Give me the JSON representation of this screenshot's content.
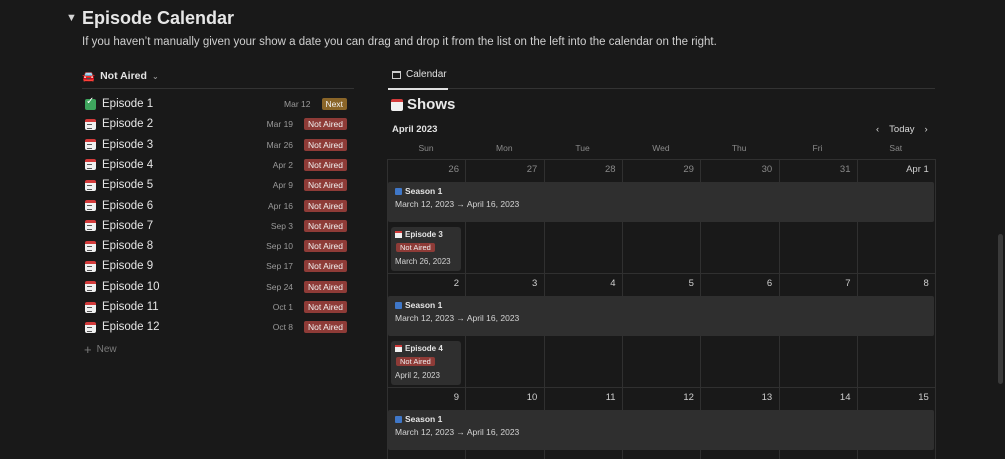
{
  "section": {
    "toggle": "▼",
    "title": "Episode Calendar",
    "description": "If you haven’t manually given your show a date you can drag and drop it from the list on the left into the calendar on the right."
  },
  "list": {
    "view_label": "Not Aired",
    "new_label": "New",
    "rows": [
      {
        "name": "Episode 1",
        "date": "Mar 12",
        "badge": "Next",
        "icon": "check-icon"
      },
      {
        "name": "Episode 2",
        "date": "Mar 19",
        "badge": "Not Aired",
        "icon": "calendar-icon"
      },
      {
        "name": "Episode 3",
        "date": "Mar 26",
        "badge": "Not Aired",
        "icon": "calendar-icon"
      },
      {
        "name": "Episode 4",
        "date": "Apr 2",
        "badge": "Not Aired",
        "icon": "calendar-icon"
      },
      {
        "name": "Episode 5",
        "date": "Apr 9",
        "badge": "Not Aired",
        "icon": "calendar-icon"
      },
      {
        "name": "Episode 6",
        "date": "Apr 16",
        "badge": "Not Aired",
        "icon": "calendar-icon"
      },
      {
        "name": "Episode 7",
        "date": "Sep 3",
        "badge": "Not Aired",
        "icon": "calendar-icon"
      },
      {
        "name": "Episode 8",
        "date": "Sep 10",
        "badge": "Not Aired",
        "icon": "calendar-icon"
      },
      {
        "name": "Episode 9",
        "date": "Sep 17",
        "badge": "Not Aired",
        "icon": "calendar-icon"
      },
      {
        "name": "Episode 10",
        "date": "Sep 24",
        "badge": "Not Aired",
        "icon": "calendar-icon"
      },
      {
        "name": "Episode 11",
        "date": "Oct 1",
        "badge": "Not Aired",
        "icon": "calendar-icon"
      },
      {
        "name": "Episode 12",
        "date": "Oct 8",
        "badge": "Not Aired",
        "icon": "calendar-icon"
      }
    ]
  },
  "calendar": {
    "tab_label": "Calendar",
    "title": "Shows",
    "month": "April 2023",
    "today_label": "Today",
    "weekdays": [
      "Sun",
      "Mon",
      "Tue",
      "Wed",
      "Thu",
      "Fri",
      "Sat"
    ],
    "weeks": [
      {
        "days": [
          "26",
          "27",
          "28",
          "29",
          "30",
          "31",
          "Apr 1"
        ],
        "span": {
          "title": "Season 1",
          "dates": "March 12, 2023 → April 16, 2023"
        },
        "episode": {
          "title": "Episode 3",
          "badge": "Not Aired",
          "date": "March 26, 2023"
        }
      },
      {
        "days": [
          "2",
          "3",
          "4",
          "5",
          "6",
          "7",
          "8"
        ],
        "span": {
          "title": "Season 1",
          "dates": "March 12, 2023 → April 16, 2023"
        },
        "episode": {
          "title": "Episode 4",
          "badge": "Not Aired",
          "date": "April 2, 2023"
        }
      },
      {
        "days": [
          "9",
          "10",
          "11",
          "12",
          "13",
          "14",
          "15"
        ],
        "span": {
          "title": "Season 1",
          "dates": "March 12, 2023 → April 16, 2023"
        }
      }
    ]
  },
  "colors": {
    "badge_red": "#8e3b37",
    "badge_next": "#8a6528",
    "background": "#191919",
    "card": "#2f2f2f"
  }
}
